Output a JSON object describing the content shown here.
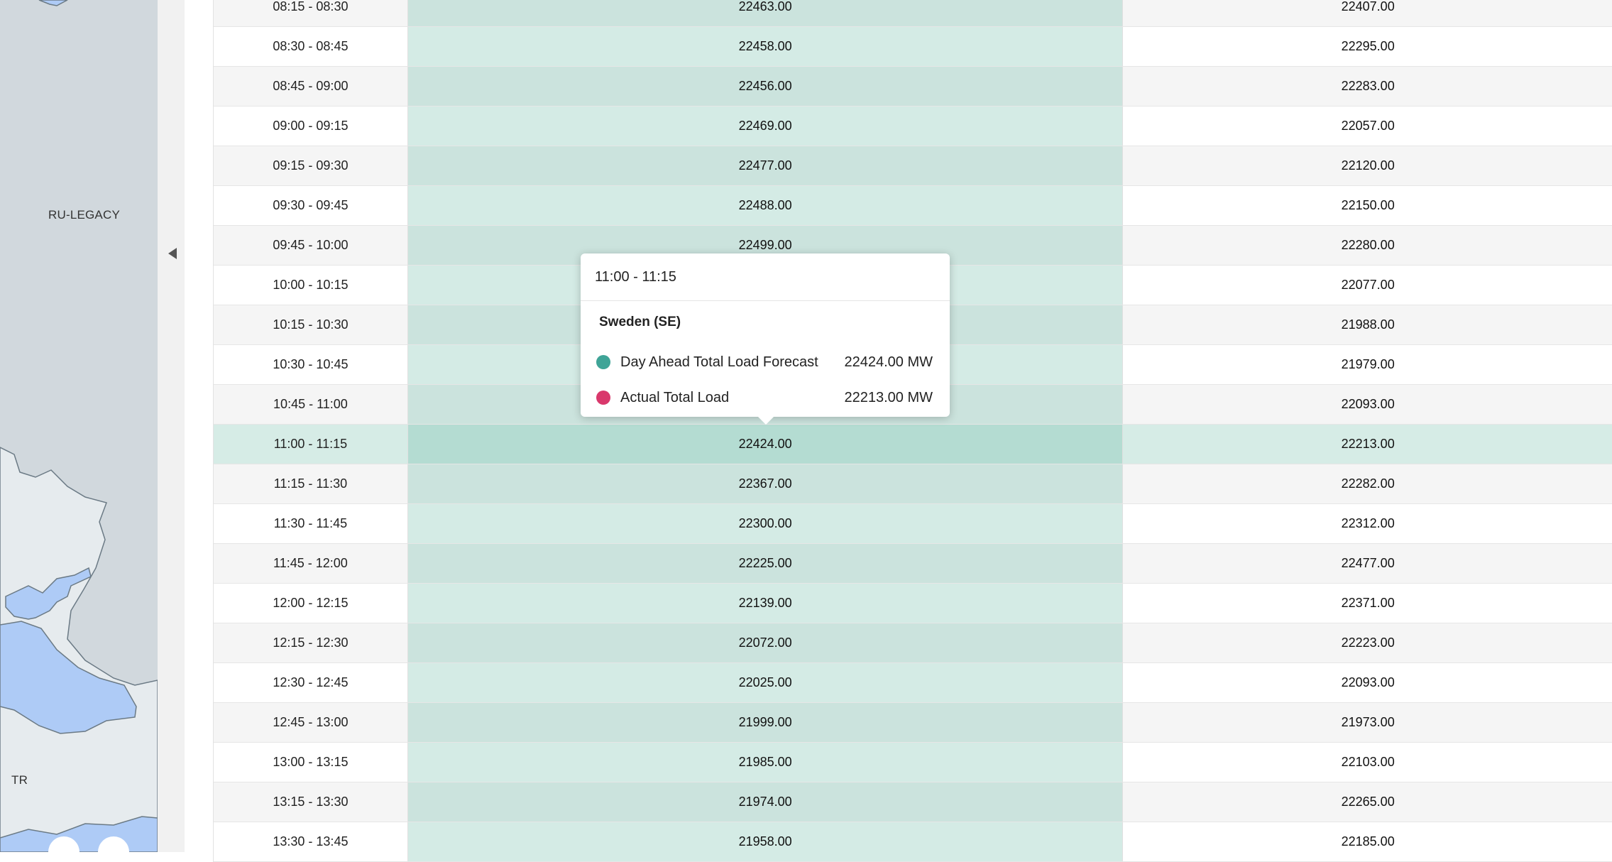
{
  "map": {
    "labels": {
      "ru": "RU-LEGACY",
      "tr": "TR"
    },
    "colors": {
      "background": "#d1d8dd",
      "land": "#e4e9ec",
      "sea": "#aecbf6",
      "border": "#6b7a85"
    }
  },
  "tooltip": {
    "title": "11:00 - 11:15",
    "country": "Sweden (SE)",
    "series": [
      {
        "name": "Day Ahead Total Load Forecast",
        "value": "22424.00 MW",
        "color": "#3fa497"
      },
      {
        "name": "Actual Total Load",
        "value": "22213.00 MW",
        "color": "#d9386c"
      }
    ]
  },
  "table": {
    "rows": [
      {
        "time": "08:15 - 08:30",
        "forecast": "22463.00",
        "actual": "22407.00"
      },
      {
        "time": "08:30 - 08:45",
        "forecast": "22458.00",
        "actual": "22295.00"
      },
      {
        "time": "08:45 - 09:00",
        "forecast": "22456.00",
        "actual": "22283.00"
      },
      {
        "time": "09:00 - 09:15",
        "forecast": "22469.00",
        "actual": "22057.00"
      },
      {
        "time": "09:15 - 09:30",
        "forecast": "22477.00",
        "actual": "22120.00"
      },
      {
        "time": "09:30 - 09:45",
        "forecast": "22488.00",
        "actual": "22150.00"
      },
      {
        "time": "09:45 - 10:00",
        "forecast": "22499.00",
        "actual": "22280.00"
      },
      {
        "time": "10:00 - 10:15",
        "forecast": "",
        "actual": "22077.00"
      },
      {
        "time": "10:15 - 10:30",
        "forecast": "",
        "actual": "21988.00"
      },
      {
        "time": "10:30 - 10:45",
        "forecast": "",
        "actual": "21979.00"
      },
      {
        "time": "10:45 - 11:00",
        "forecast": "",
        "actual": "22093.00"
      },
      {
        "time": "11:00 - 11:15",
        "forecast": "22424.00",
        "actual": "22213.00",
        "highlight": true
      },
      {
        "time": "11:15 - 11:30",
        "forecast": "22367.00",
        "actual": "22282.00"
      },
      {
        "time": "11:30 - 11:45",
        "forecast": "22300.00",
        "actual": "22312.00"
      },
      {
        "time": "11:45 - 12:00",
        "forecast": "22225.00",
        "actual": "22477.00"
      },
      {
        "time": "12:00 - 12:15",
        "forecast": "22139.00",
        "actual": "22371.00"
      },
      {
        "time": "12:15 - 12:30",
        "forecast": "22072.00",
        "actual": "22223.00"
      },
      {
        "time": "12:30 - 12:45",
        "forecast": "22025.00",
        "actual": "22093.00"
      },
      {
        "time": "12:45 - 13:00",
        "forecast": "21999.00",
        "actual": "21973.00"
      },
      {
        "time": "13:00 - 13:15",
        "forecast": "21985.00",
        "actual": "22103.00"
      },
      {
        "time": "13:15 - 13:30",
        "forecast": "21974.00",
        "actual": "22265.00"
      },
      {
        "time": "13:30 - 13:45",
        "forecast": "21958.00",
        "actual": "22185.00"
      }
    ]
  }
}
